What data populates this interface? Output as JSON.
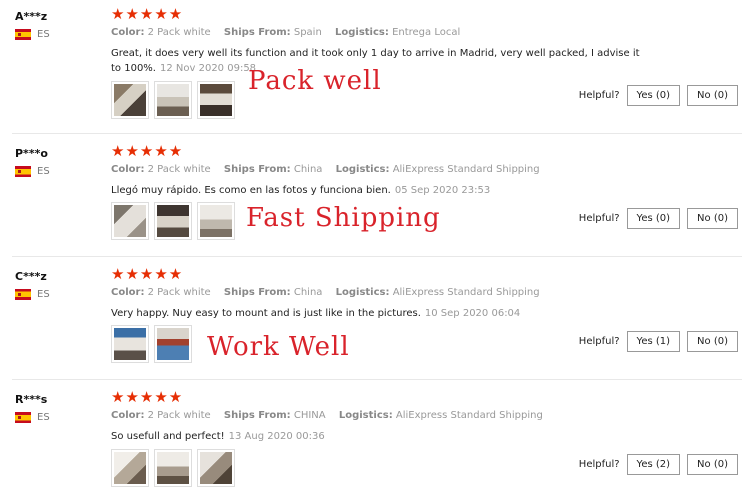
{
  "labels": {
    "color": "Color:",
    "ships_from": "Ships From:",
    "logistics": "Logistics:",
    "helpful": "Helpful?"
  },
  "stars": "★★★★★",
  "reviews": [
    {
      "user": "A***z",
      "country": "ES",
      "rating": 5,
      "color": "2 Pack white",
      "ships_from": "Spain",
      "logistics": "Entrega Local",
      "comment": "Great, it does very well its function and it took only 1 day to arrive in Madrid, very well packed, I advise it to 100%.",
      "date": "12 Nov 2020 09:58",
      "overlay": "Pack well",
      "yes": "Yes (0)",
      "no": "No (0)",
      "photos": [
        "washer-photo",
        "washer-photo",
        "washer-photo"
      ]
    },
    {
      "user": "P***o",
      "country": "ES",
      "rating": 5,
      "color": "2 Pack white",
      "ships_from": "China",
      "logistics": "AliExpress Standard Shipping",
      "comment": "Llegó muy rápido. Es como en las fotos y funciona bien.",
      "date": "05 Sep 2020 23:53",
      "overlay": "Fast Shipping",
      "yes": "Yes (0)",
      "no": "No (0)",
      "photos": [
        "shelf-photo",
        "shelf-photo",
        "shelf-photo"
      ]
    },
    {
      "user": "C***z",
      "country": "ES",
      "rating": 5,
      "color": "2 Pack white",
      "ships_from": "China",
      "logistics": "AliExpress Standard Shipping",
      "comment": "Very happy. Nuy easy to mount and is just like in the pictures.",
      "date": "10 Sep 2020 06:04",
      "overlay": "Work Well",
      "yes": "Yes (1)",
      "no": "No (0)",
      "photos": [
        "mounted-shelf-photo",
        "mounted-shelf-photo"
      ]
    },
    {
      "user": "R***s",
      "country": "ES",
      "rating": 5,
      "color": "2 Pack white",
      "ships_from": "CHINA",
      "logistics": "AliExpress Standard Shipping",
      "comment": "So usefull and perfect!",
      "date": "13 Aug 2020 00:36",
      "overlay": "",
      "yes": "Yes (2)",
      "no": "No (0)",
      "photos": [
        "shelf-photo",
        "shelf-photo",
        "shelf-photo"
      ]
    }
  ],
  "colors": {
    "star": "#e62e04",
    "overlay_text": "#d9232b",
    "meta_text": "#999999"
  }
}
